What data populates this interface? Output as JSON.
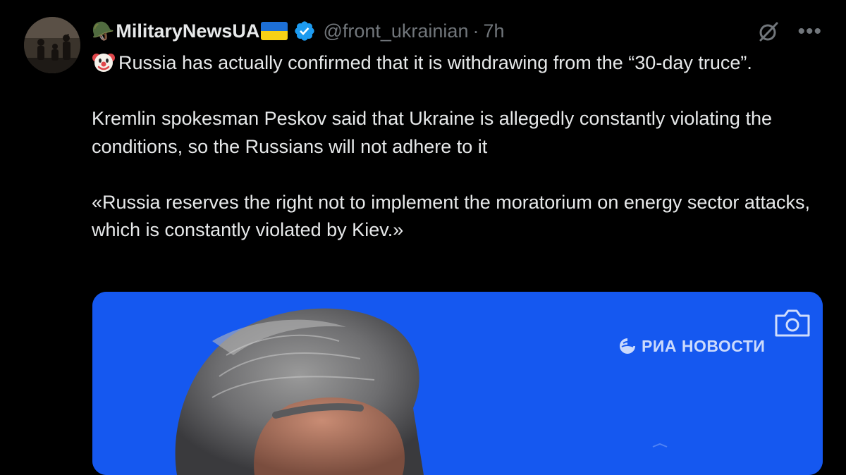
{
  "tweet": {
    "author": {
      "display_name": "MilitaryNewsUA",
      "handle": "@front_ukrainian",
      "separator": "·",
      "time": "7h",
      "prefix_emoji": "🪖",
      "verified": true
    },
    "text": {
      "line1": "Russia has actually confirmed that it is withdrawing from the “30-day truce”.",
      "paragraph2": "Kremlin spokesman Peskov said that Ukraine is allegedly constantly violating the conditions, so the Russians will not adhere to it",
      "paragraph3": "«Russia reserves the right not to implement the moratorium on energy sector attacks, which is constantly violated by Kiev.»"
    },
    "media": {
      "watermark": "РИА НОВОСТИ"
    },
    "icons": {
      "avatar": "avatar",
      "clown": "clown-emoji-icon",
      "verified": "verified-badge-icon",
      "grok": "grok-icon",
      "more": "more-icon",
      "camera": "camera-icon"
    }
  },
  "colors": {
    "background": "#000000",
    "text_primary": "#e7e9ea",
    "text_secondary": "#71767b",
    "verified_blue": "#1d9bf0",
    "media_background": "#1558f0"
  }
}
